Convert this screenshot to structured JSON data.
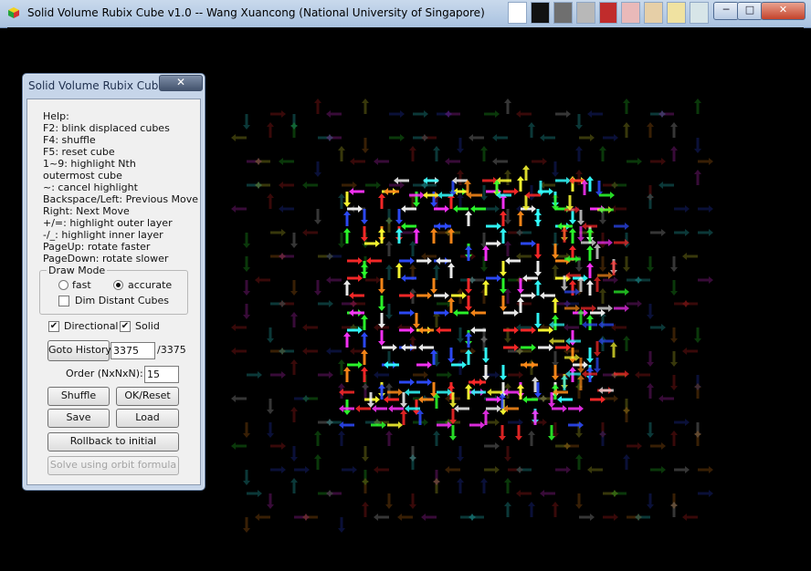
{
  "window": {
    "title": "Solid Volume Rubix Cube v1.0 -- Wang Xuancong (National University of Singapore)",
    "minimize_label": "─",
    "maximize_label": "□",
    "close_label": "✕"
  },
  "taskbar_palette": [
    "#ffffff",
    "#111111",
    "#6f6f6f",
    "#b8b8b8",
    "#c02c2c",
    "#e9b9b9",
    "#e6cfa7",
    "#f0e2a1",
    "#d7e5e8"
  ],
  "panel": {
    "title": "Solid Volume Rubix Cube",
    "close_label": "✕",
    "help": {
      "heading": "Help:",
      "lines": [
        "F2: blink displaced cubes",
        "F4: shuffle",
        "F5: reset cube",
        "1~9: highlight Nth outermost cube",
        "~: cancel highlight",
        "Backspace/Left: Previous Move",
        "Right: Next Move",
        "+/=: highlight outer layer",
        "-/_: highlight inner layer",
        "PageUp: rotate faster",
        "PageDown: rotate slower"
      ]
    },
    "draw_mode": {
      "label": "Draw Mode",
      "options": [
        "fast",
        "accurate"
      ],
      "selected": "accurate",
      "dim_label": "Dim Distant Cubes",
      "dim_checked": false
    },
    "directional": {
      "label": "Directional",
      "checked": true
    },
    "solid": {
      "label": "Solid",
      "checked": true
    },
    "goto_history_label": "Goto History",
    "history_value": "3375",
    "history_total": "/3375",
    "order_label": "Order (NxNxN):",
    "order_value": "15",
    "shuffle_label": "Shuffle",
    "ok_reset_label": "OK/Reset",
    "save_label": "Save",
    "load_label": "Load",
    "rollback_label": "Rollback to initial",
    "solve_label": "Solve using orbit formula",
    "solve_enabled": false
  },
  "colors": {
    "arrows": [
      "#ff2a2a",
      "#2dff2d",
      "#ffff33",
      "#33ffff",
      "#ff33ff",
      "#2e4cff",
      "#ff8c1a",
      "#f5f5f5"
    ],
    "background": "#000000"
  },
  "icons": {
    "app": "rubik-cube-icon",
    "radio_off": "radio-unselected-icon",
    "radio_on": "radio-selected-icon",
    "check": "checkmark-icon"
  }
}
